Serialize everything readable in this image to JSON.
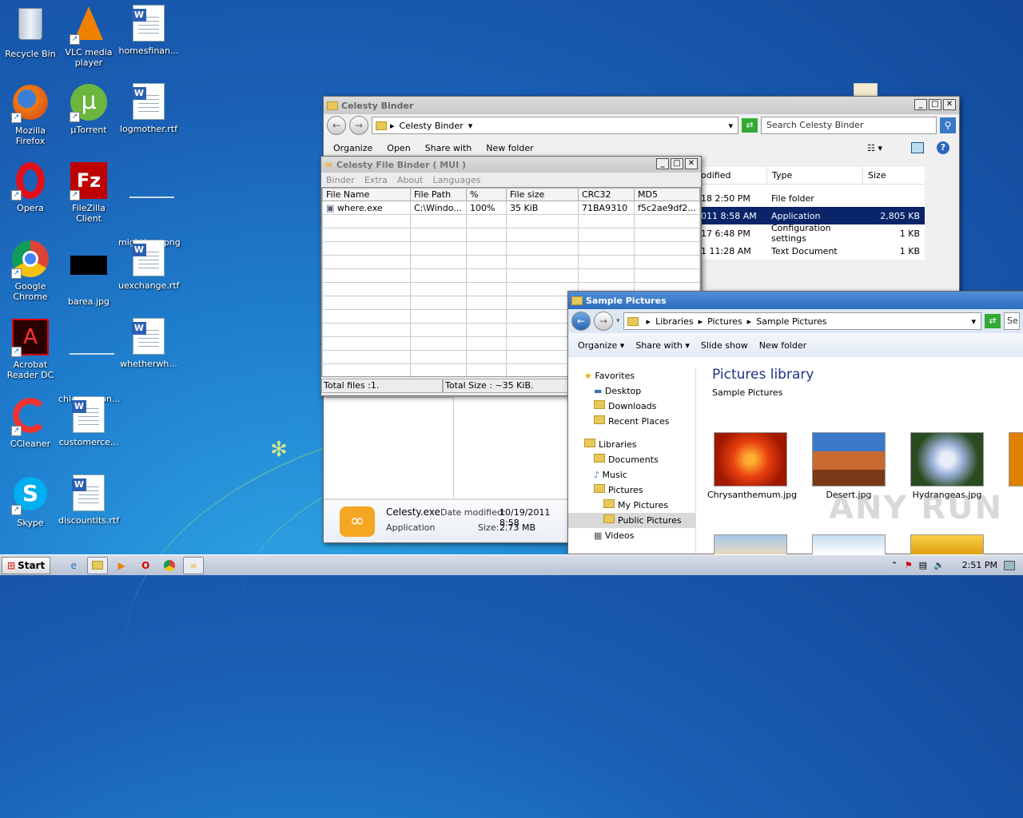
{
  "desktop": {
    "icons": [
      {
        "id": "recycle",
        "label": "Recycle Bin"
      },
      {
        "id": "vlc",
        "label": "VLC media player"
      },
      {
        "id": "homesfinan",
        "label": "homesfinan..."
      },
      {
        "id": "firefox",
        "label": "Mozilla Firefox"
      },
      {
        "id": "utorrent",
        "label": "µTorrent"
      },
      {
        "id": "logmother",
        "label": "logmother.rtf"
      },
      {
        "id": "opera",
        "label": "Opera"
      },
      {
        "id": "filezilla",
        "label": "FileZilla Client"
      },
      {
        "id": "mightless",
        "label": "mightless.png"
      },
      {
        "id": "chrome",
        "label": "Google Chrome"
      },
      {
        "id": "barea",
        "label": "barea.jpg"
      },
      {
        "id": "uexchange",
        "label": "uexchange.rtf"
      },
      {
        "id": "acrobat",
        "label": "Acrobat Reader DC"
      },
      {
        "id": "chicagomon",
        "label": "chicagomon..."
      },
      {
        "id": "whetherwh",
        "label": "whetherwh..."
      },
      {
        "id": "ccleaner",
        "label": "CCleaner"
      },
      {
        "id": "customerce",
        "label": "customerce..."
      },
      {
        "id": "skype",
        "label": "Skype"
      },
      {
        "id": "discountits",
        "label": "discountits.rtf"
      }
    ]
  },
  "explorer1": {
    "title": "Celesty Binder",
    "address": "Celesty Binder",
    "search_placeholder": "Search Celesty Binder",
    "cmd": {
      "organize": "Organize",
      "open": "Open",
      "share": "Share with",
      "newfolder": "New folder"
    },
    "cols": {
      "modified": "odified",
      "type": "Type",
      "size": "Size"
    },
    "rows": [
      {
        "modified": "18 2:50 PM",
        "type": "File folder",
        "size": ""
      },
      {
        "modified": "011 8:58 AM",
        "type": "Application",
        "size": "2,805 KB"
      },
      {
        "modified": "17 6:48 PM",
        "type": "Configuration settings",
        "size": "1 KB"
      },
      {
        "modified": "1 11:28 AM",
        "type": "Text Document",
        "size": "1 KB"
      }
    ],
    "details": {
      "name": "Celesty.exe",
      "modified_label": "Date modified:",
      "modified": "10/19/2011 8:58",
      "type": "Application",
      "size_label": "Size:",
      "size": "2.73 MB"
    }
  },
  "binder": {
    "title": "Celesty File Binder ( MUI )",
    "menu": [
      "Binder",
      "Extra",
      "About",
      "Languages"
    ],
    "cols": [
      "File Name",
      "File Path",
      "%",
      "File size",
      "CRC32",
      "MD5"
    ],
    "rows": [
      [
        "where.exe",
        "C:\\Windo...",
        "100%",
        "35 KiB",
        "71BA9310",
        "f5c2ae9df2..."
      ]
    ],
    "status_files": "Total files :1.",
    "status_size": "Total Size : ~35 KiB."
  },
  "pictures": {
    "title": "Sample Pictures",
    "crumbs": [
      "Libraries",
      "Pictures",
      "Sample Pictures"
    ],
    "search": "Se",
    "cmd": {
      "organize": "Organize",
      "share": "Share with",
      "slideshow": "Slide show",
      "newfolder": "New folder"
    },
    "tree": {
      "favorites": "Favorites",
      "desktop": "Desktop",
      "downloads": "Downloads",
      "recent": "Recent Places",
      "libraries": "Libraries",
      "documents": "Documents",
      "music": "Music",
      "pictures": "Pictures",
      "mypictures": "My Pictures",
      "publicpictures": "Public Pictures",
      "videos": "Videos"
    },
    "library_title": "Pictures library",
    "library_sub": "Sample Pictures",
    "thumbs": [
      "Chrysanthemum.jpg",
      "Desert.jpg",
      "Hydrangeas.jpg"
    ]
  },
  "taskbar": {
    "start": "Start",
    "time": "2:51 PM"
  },
  "watermark": "ANY RUN",
  "colors": {
    "selection": "#0a246a",
    "desktop": "#1a5fb4"
  }
}
